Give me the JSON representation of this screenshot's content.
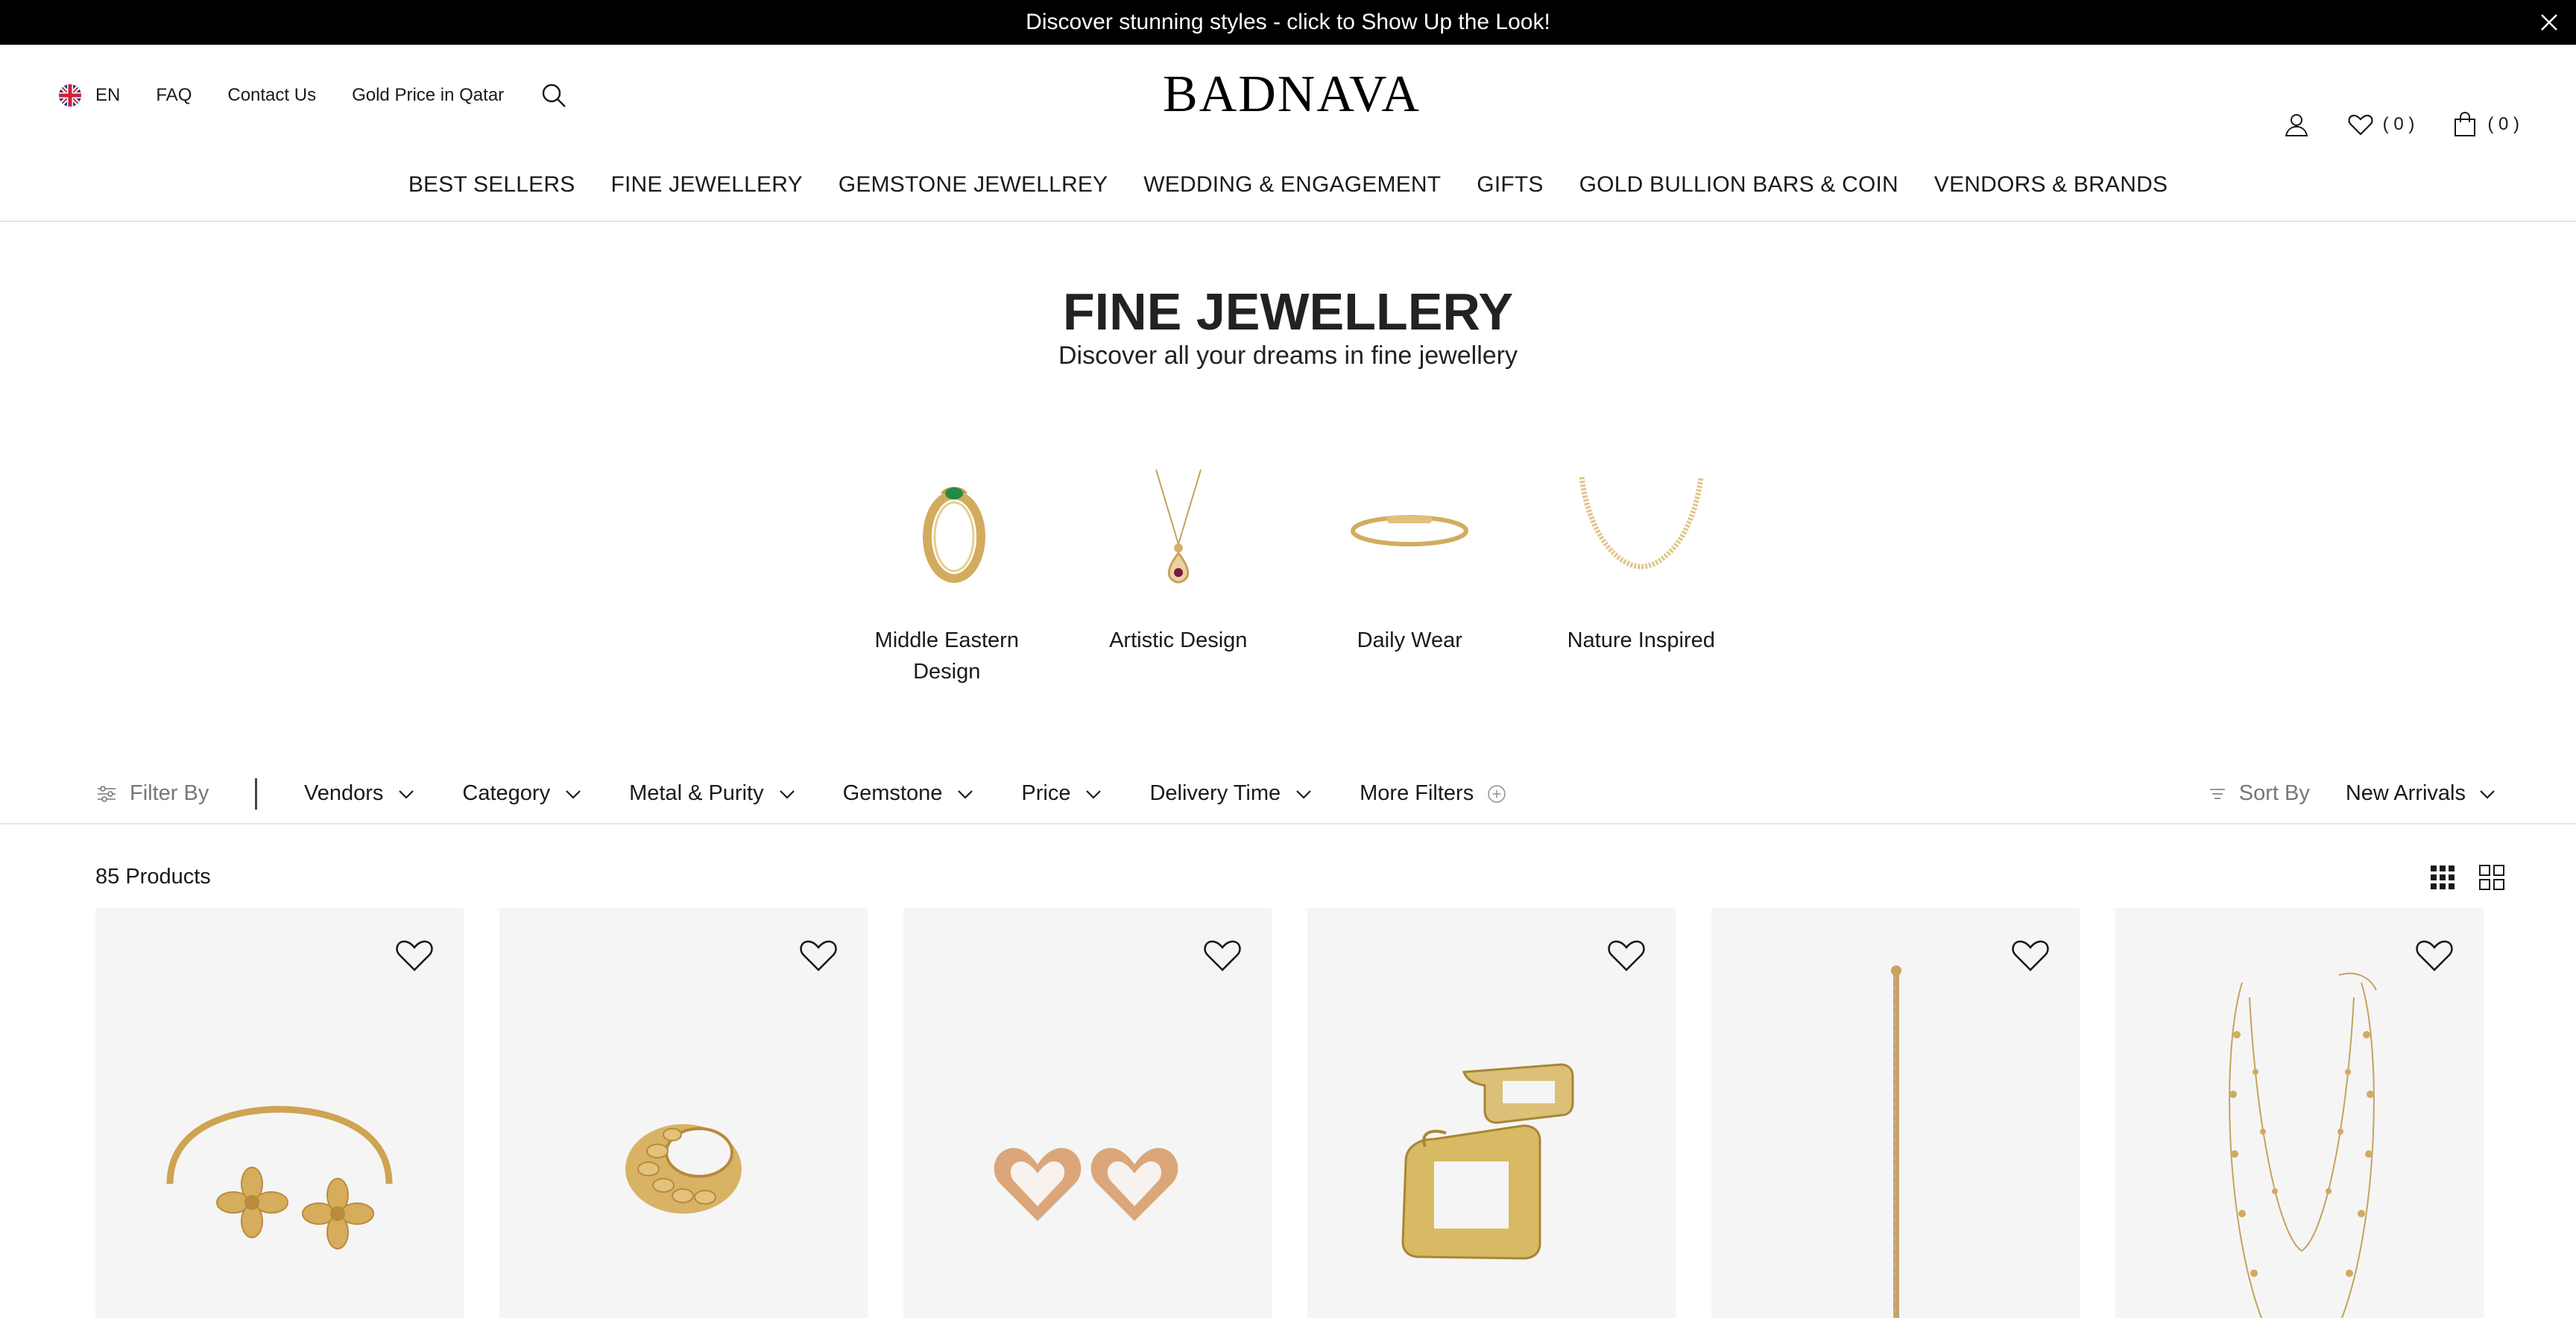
{
  "announcement": {
    "text": "Discover stunning styles - click to Show Up the Look!"
  },
  "header": {
    "language": "EN",
    "links": [
      "FAQ",
      "Contact Us",
      "Gold Price in Qatar"
    ],
    "logo": "BADNAVA",
    "wishlist_count": "( 0 )",
    "cart_count": "( 0 )"
  },
  "nav": [
    "BEST SELLERS",
    "FINE JEWELLERY",
    "GEMSTONE JEWELLREY",
    "WEDDING & ENGAGEMENT",
    "GIFTS",
    "GOLD BULLION BARS & COIN",
    "VENDORS & BRANDS"
  ],
  "hero": {
    "title": "FINE JEWELLERY",
    "subtitle": "Discover all your dreams in fine jewellery"
  },
  "categories": [
    {
      "label": "Middle Eastern Design",
      "icon": "ring-icon"
    },
    {
      "label": "Artistic Design",
      "icon": "pendant-icon"
    },
    {
      "label": "Daily Wear",
      "icon": "bangle-icon"
    },
    {
      "label": "Nature Inspired",
      "icon": "chain-necklace-icon"
    }
  ],
  "filters": {
    "filter_by": "Filter By",
    "items": [
      "Vendors",
      "Category",
      "Metal & Purity",
      "Gemstone",
      "Price",
      "Delivery Time"
    ],
    "more": "More Filters",
    "sort_label": "Sort By",
    "sort_value": "New Arrivals"
  },
  "products": {
    "count": "85 Products",
    "items": [
      {
        "icon": "flower-bangle"
      },
      {
        "icon": "gold-ring"
      },
      {
        "icon": "heart-earrings"
      },
      {
        "icon": "square-hoop-earrings"
      },
      {
        "icon": "beaded-bracelet"
      },
      {
        "icon": "layered-necklace"
      }
    ]
  },
  "colors": {
    "gold": "#d4aa5c",
    "rose_gold": "#d9a57a",
    "text": "#1a1a1a",
    "muted": "#777777",
    "card_bg": "#f5f5f5"
  }
}
